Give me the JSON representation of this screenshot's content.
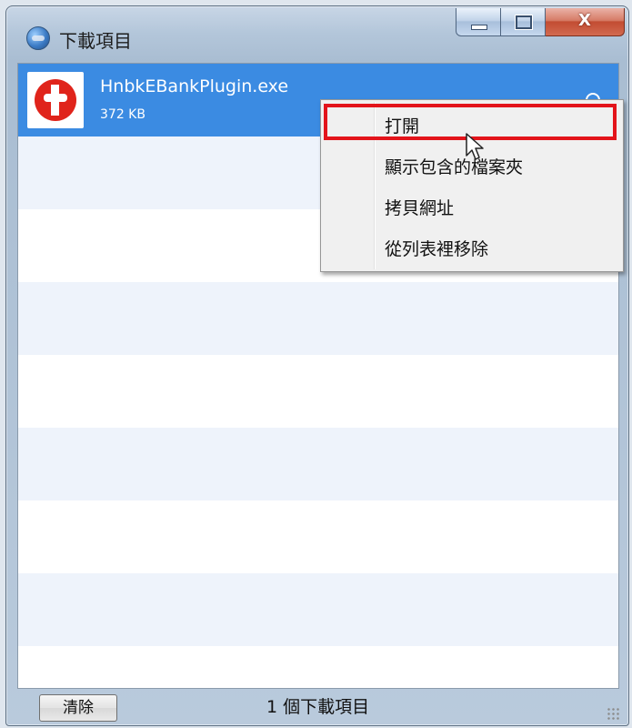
{
  "window": {
    "title": "下載項目",
    "close_label": "X"
  },
  "download_item": {
    "file_name": "HnbkEBankPlugin.exe",
    "file_size": "372 KB"
  },
  "context_menu": {
    "items": [
      {
        "label": "打開"
      },
      {
        "label": "顯示包含的檔案夾"
      },
      {
        "label": "拷貝網址"
      },
      {
        "label": "從列表裡移除"
      }
    ],
    "highlighted_index": 0,
    "highlight_color": "#e3141b"
  },
  "statusbar": {
    "clear_label": "清除",
    "status_text": "1 個下載項目"
  },
  "colors": {
    "selection": "#3b8be2",
    "stripe": "#eef3fb"
  }
}
